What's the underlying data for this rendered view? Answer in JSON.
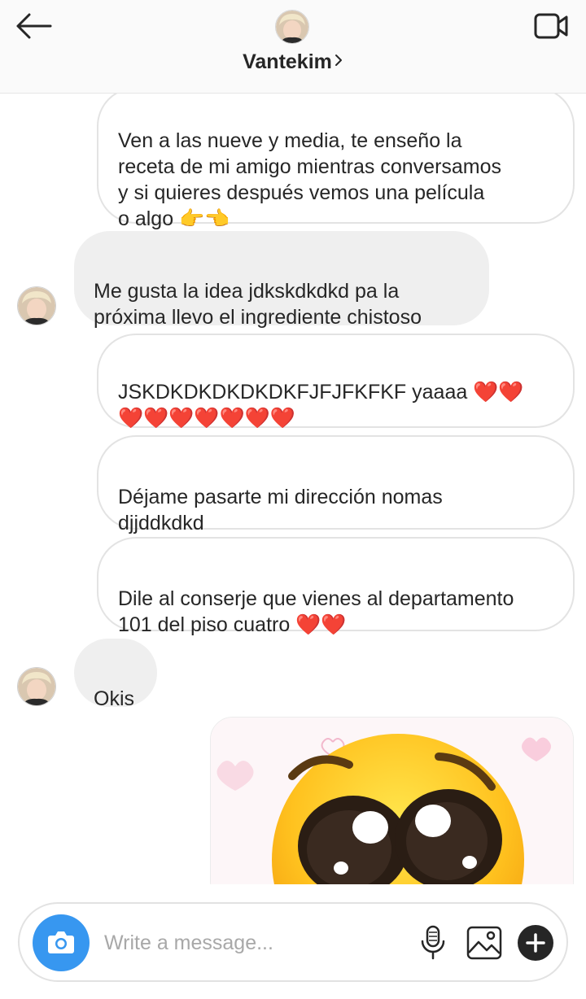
{
  "header": {
    "title": "Vantekim",
    "chevron": "›"
  },
  "messages": [
    {
      "direction": "outgoing",
      "text": "Ven a las nueve y media, te enseño la\nreceta de mi amigo mientras conversamos\ny si quieres después vemos una película\no algo 👉👈"
    },
    {
      "direction": "incoming",
      "text": "Me gusta la idea jdkskdkdkd pa la\npróxima llevo el ingrediente chistoso"
    },
    {
      "direction": "outgoing",
      "text": "JSKDKDKDKDKDKFJFJFKFKF yaaaa ❤️❤️\n❤️❤️❤️❤️❤️❤️❤️"
    },
    {
      "direction": "outgoing",
      "text": "Déjame pasarte mi dirección nomas\ndjjddkdkd"
    },
    {
      "direction": "outgoing",
      "text": "Dile al conserje que vienes al departamento\n101 del piso cuatro ❤️❤️"
    },
    {
      "direction": "incoming",
      "text": "Okis"
    },
    {
      "direction": "outgoing",
      "type": "image",
      "content": "pleading-face-emoji-sticker"
    }
  ],
  "composer": {
    "placeholder": "Write a message..."
  },
  "icons": {
    "back": "arrow-left-icon",
    "video": "video-camera-icon",
    "camera": "camera-icon",
    "mic": "microphone-icon",
    "gallery": "image-gallery-icon",
    "plus": "plus-icon"
  },
  "colors": {
    "accent": "#3797f0",
    "incoming_bubble": "#efefef",
    "outgoing_border": "#e3e3e3",
    "heart": "#e0242b"
  }
}
